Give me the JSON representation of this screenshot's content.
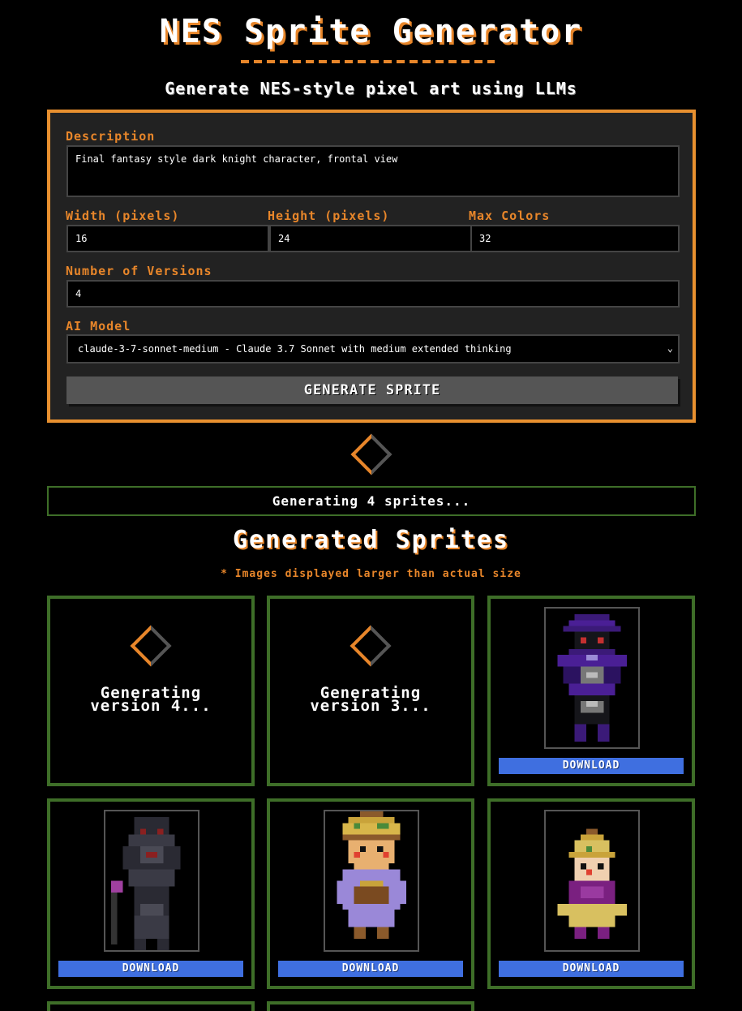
{
  "header": {
    "title": "NES Sprite Generator",
    "subtitle": "Generate NES-style pixel art using LLMs"
  },
  "form": {
    "description_label": "Description",
    "description_value": "Final fantasy style dark knight character, frontal view",
    "width_label": "Width (pixels)",
    "width_value": "16",
    "height_label": "Height (pixels)",
    "height_value": "24",
    "colors_label": "Max Colors",
    "colors_value": "32",
    "versions_label": "Number of Versions",
    "versions_value": "4",
    "model_label": "AI Model",
    "model_value": "claude-3-7-sonnet-medium - Claude 3.7 Sonnet with medium extended thinking",
    "generate_label": "GENERATE SPRITE"
  },
  "status": {
    "text": "Generating 4 sprites..."
  },
  "results": {
    "heading": "Generated Sprites",
    "note": "* Images displayed larger than actual size",
    "cards": [
      {
        "state": "generating",
        "text_line1": "Generating",
        "text_line2": "version 4..."
      },
      {
        "state": "generating",
        "text_line1": "Generating",
        "text_line2": "version 3..."
      },
      {
        "state": "done",
        "sprite": "purple-dark-knight",
        "download_label": "DOWNLOAD"
      },
      {
        "state": "done",
        "sprite": "gray-knight-staff",
        "download_label": "DOWNLOAD"
      },
      {
        "state": "done",
        "sprite": "yellow-hat-character",
        "download_label": "DOWNLOAD"
      },
      {
        "state": "done",
        "sprite": "pointed-hat-character",
        "download_label": "DOWNLOAD"
      }
    ]
  },
  "colors": {
    "accent": "#e8862a",
    "card_border": "#3e6e28",
    "download": "#3f6fe0",
    "button": "#555555"
  }
}
